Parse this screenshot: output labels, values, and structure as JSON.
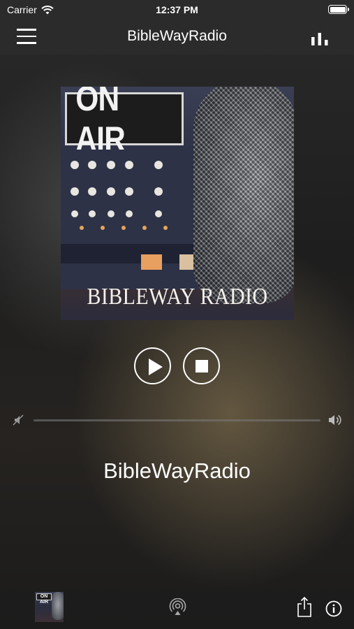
{
  "status_bar": {
    "carrier": "Carrier",
    "time": "12:37 PM",
    "wifi_icon": "wifi-icon",
    "battery_icon": "battery-full-icon"
  },
  "nav_bar": {
    "title": "BibleWayRadio",
    "left_icon": "hamburger-menu-icon",
    "right_icon": "bar-chart-icon"
  },
  "artwork": {
    "sign_text": "ON AIR",
    "brand_text": "BIBLEWAY RADIO"
  },
  "controls": {
    "play_icon": "play-icon",
    "stop_icon": "stop-icon"
  },
  "volume": {
    "min_icon": "speaker-mute-icon",
    "max_icon": "speaker-loud-icon"
  },
  "now_playing": {
    "station_name": "BibleWayRadio"
  },
  "bottom_bar": {
    "thumb_text": "ON AIR",
    "airplay_icon": "airplay-icon",
    "share_icon": "share-icon",
    "info_icon": "info-icon"
  },
  "colors": {
    "bar_background": "#2b2b2b",
    "text": "#ffffff"
  }
}
